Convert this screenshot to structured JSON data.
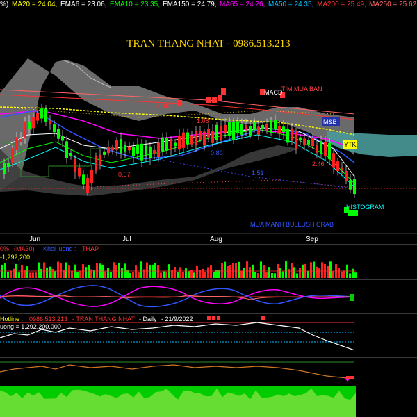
{
  "header": {
    "indicators": [
      {
        "text": "%)",
        "color": "#ffffff"
      },
      {
        "text": "MA20 = 24.04,",
        "color": "#ffff00"
      },
      {
        "text": "EMA6 = 23.06,",
        "color": "#ffffff"
      },
      {
        "text": "EMA10 = 23.35,",
        "color": "#00ff00"
      },
      {
        "text": "EMA150 = 24.79,",
        "color": "#ffffff"
      },
      {
        "text": "MA65 = 24.26,",
        "color": "#ff00ff"
      },
      {
        "text": "MA50 = 24.35,",
        "color": "#00bfff"
      },
      {
        "text": "MA200 = 25.49,",
        "color": "#ff3333"
      },
      {
        "text": "MA250 = 25.62,",
        "color": "#ff6666"
      },
      {
        "text": "MA20 =",
        "color": "#ffff00"
      }
    ],
    "title": "TRAN THANG NHAT - 0986.513.213"
  },
  "price_panel": {
    "annotations": {
      "mua_ban": "TIM MUA BAN",
      "macd": "MACD",
      "m_and_b": "M&B",
      "ytk": "YTK",
      "histogram": "HISTOGRAM",
      "mua_manh": "MUA MANH  BULLUSH CRAB"
    },
    "levels": [
      "0.81",
      "1.08",
      "0.80",
      "0.57",
      "1.51",
      "2.46"
    ],
    "month_labels": [
      "Jun",
      "Jul",
      "Aug",
      "Sep"
    ]
  },
  "volume_panel": {
    "ma_label": "(MA30)",
    "ma_prefix": "0%",
    "khoi_luong": "Khoi luong :",
    "thap": "THAP",
    "value": "-1,292,200"
  },
  "line_panel": {
    "hotline": "Hotline :",
    "phone": "0986.513.213",
    "author": "- TRAN THANG NHAT",
    "period": "- Daily",
    "date": "- 21/9/2022",
    "volume": "uong = 1,292,200.000"
  },
  "colors": {
    "background": "#000000",
    "bull": "#00ff00",
    "bear": "#ff2020",
    "title": "#ffd700",
    "cloud_gray": "#8a8a8a",
    "cloud_teal": "#4a9a9a"
  }
}
